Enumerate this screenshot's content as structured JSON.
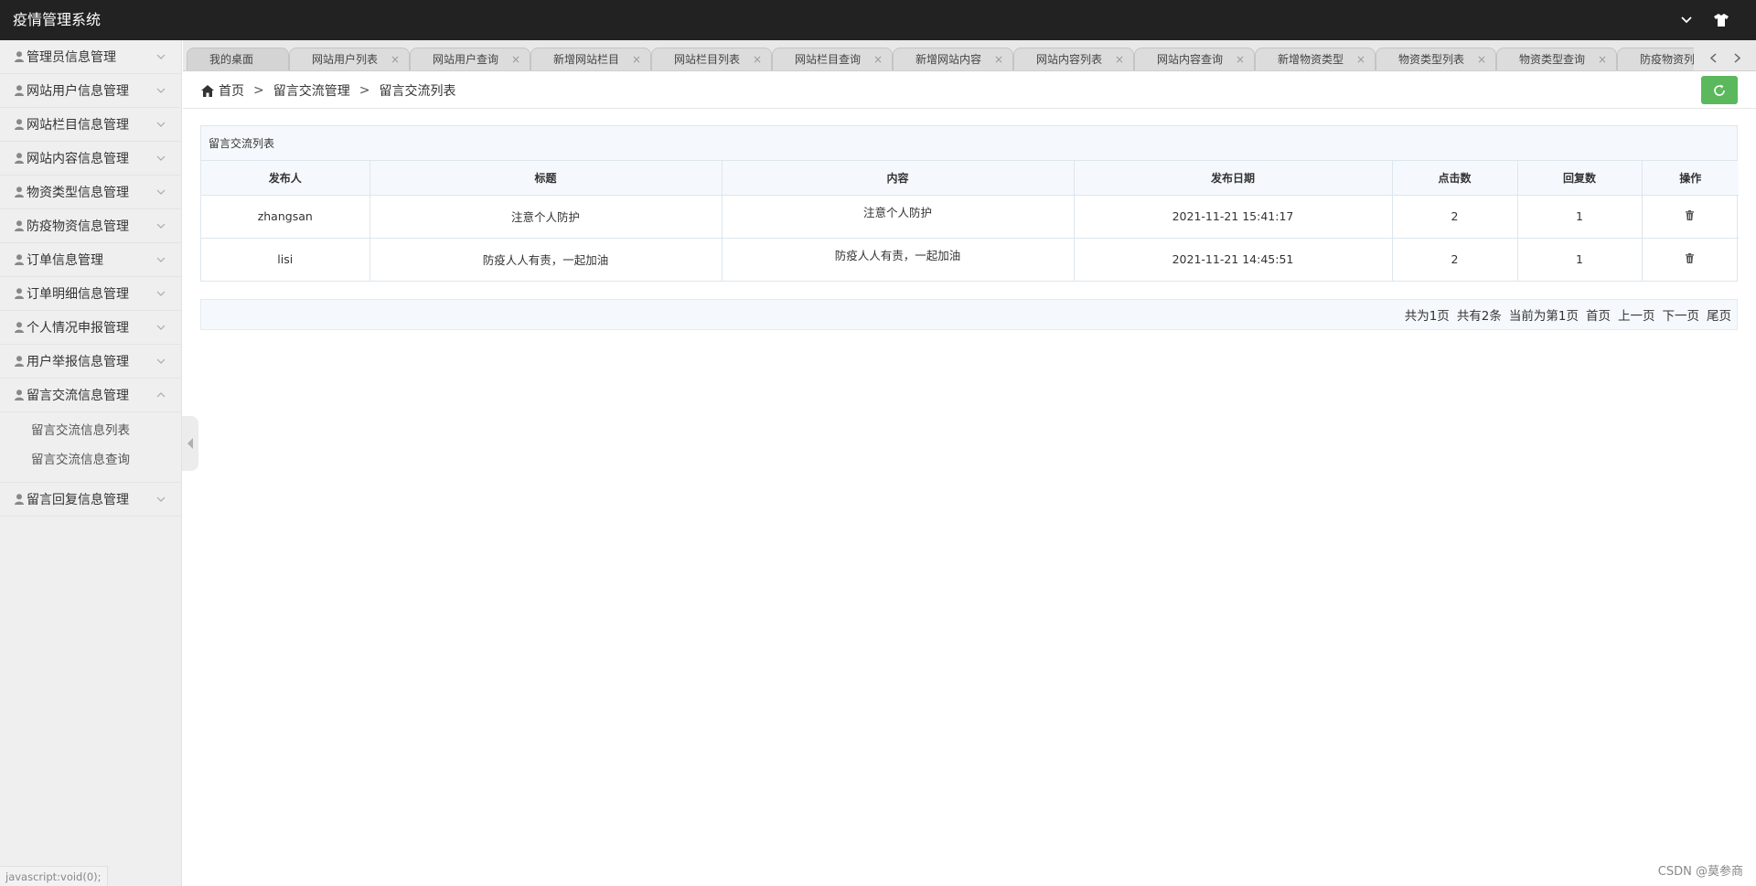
{
  "header": {
    "title": "疫情管理系统"
  },
  "sidebar": {
    "items": [
      {
        "label": "管理员信息管理"
      },
      {
        "label": "网站用户信息管理"
      },
      {
        "label": "网站栏目信息管理"
      },
      {
        "label": "网站内容信息管理"
      },
      {
        "label": "物资类型信息管理"
      },
      {
        "label": "防疫物资信息管理"
      },
      {
        "label": "订单信息管理"
      },
      {
        "label": "订单明细信息管理"
      },
      {
        "label": "个人情况申报管理"
      },
      {
        "label": "用户举报信息管理"
      },
      {
        "label": "留言交流信息管理"
      },
      {
        "label": "留言回复信息管理"
      }
    ],
    "submenu": [
      {
        "label": "留言交流信息列表"
      },
      {
        "label": "留言交流信息查询"
      }
    ],
    "status_url": "javascript:void(0);"
  },
  "tabs": [
    {
      "label": "我的桌面"
    },
    {
      "label": "网站用户列表"
    },
    {
      "label": "网站用户查询"
    },
    {
      "label": "新增网站栏目"
    },
    {
      "label": "网站栏目列表"
    },
    {
      "label": "网站栏目查询"
    },
    {
      "label": "新增网站内容"
    },
    {
      "label": "网站内容列表"
    },
    {
      "label": "网站内容查询"
    },
    {
      "label": "新增物资类型"
    },
    {
      "label": "物资类型列表"
    },
    {
      "label": "物资类型查询"
    },
    {
      "label": "防疫物资列"
    }
  ],
  "tab_close": "×",
  "breadcrumb": {
    "home": "首页",
    "sep": ">",
    "level1": "留言交流管理",
    "level2": "留言交流列表"
  },
  "panel": {
    "title": "留言交流列表"
  },
  "table": {
    "columns": [
      "发布人",
      "标题",
      "内容",
      "发布日期",
      "点击数",
      "回复数",
      "操作"
    ],
    "rows": [
      {
        "author": "zhangsan",
        "title": "注意个人防护",
        "content": "注意个人防护",
        "date": "2021-11-21 15:41:17",
        "clicks": "2",
        "replies": "1"
      },
      {
        "author": "lisi",
        "title": "防疫人人有责，一起加油",
        "content": "防疫人人有责，一起加油",
        "date": "2021-11-21 14:45:51",
        "clicks": "2",
        "replies": "1"
      }
    ]
  },
  "pager": {
    "total_pages": "共为1页",
    "total_records": "共有2条",
    "current": "当前为第1页",
    "first": "首页",
    "prev": "上一页",
    "next": "下一页",
    "last": "尾页"
  },
  "watermark": "CSDN @莫参商",
  "colors": {
    "header_bg": "#222222",
    "sidebar_bg": "#efefef",
    "refresh_btn": "#5cb85c",
    "table_head_bg": "#f5f9fd"
  }
}
